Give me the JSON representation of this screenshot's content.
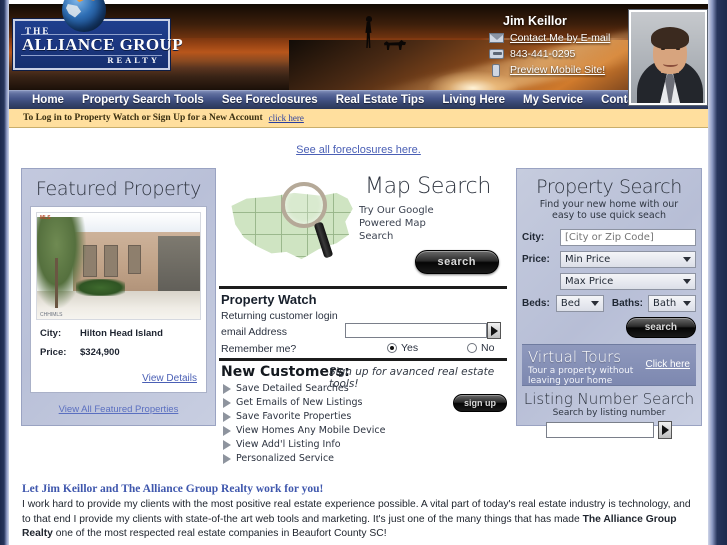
{
  "brand": {
    "logo_the": "THE",
    "logo_main": "ALLIANCE GROUP",
    "logo_realty": "REALTY"
  },
  "agent": {
    "name": "Jim Keillor",
    "email_link": "Contact Me by E-mail",
    "phone": "843-441-0295",
    "mobile_link": "Preview Mobile Site!"
  },
  "nav": {
    "items": [
      "Home",
      "Property Search Tools",
      "See Foreclosures",
      "Real Estate Tips",
      "Living Here",
      "My Service",
      "Contact"
    ]
  },
  "loginbar": {
    "text": "To Log in to Property Watch or Sign Up for a New Account",
    "link": "click here"
  },
  "foreclosure_link": "See all foreclosures here.",
  "featured": {
    "title": "Featured Property",
    "image_tag": "MLS",
    "image_mls": "CHHIMLS",
    "city_label": "City:",
    "city_value": "Hilton Head Island",
    "price_label": "Price:",
    "price_value": "$324,900",
    "view_details": "View Details",
    "view_all": "View All Featured Properties"
  },
  "map_search": {
    "title": "Map Search",
    "subtitle": "Try Our Google Powered Map Search",
    "button": "search"
  },
  "property_watch": {
    "title": "Property Watch",
    "subtitle": "Returning customer login",
    "email_label": "email Address",
    "email_value": "",
    "remember_label": "Remember me?",
    "yes_label": "Yes",
    "no_label": "No",
    "remember_selected": "Yes"
  },
  "new_customers": {
    "title": "New Customers:",
    "subtitle": "Sign up for avanced real estate tools!",
    "benefits_left": [
      "Save Detailed Searches",
      "Get Emails of New Listings",
      "Save Favorite Properties"
    ],
    "benefits_right": [
      "View Homes Any Mobile Device",
      "View Add'l Listing Info",
      "Personalized Service"
    ],
    "signup_button": "sign up"
  },
  "property_search": {
    "title": "Property Search",
    "subtitle_line1": "Find your new home with our",
    "subtitle_line2": "easy to use quick seach",
    "city_label": "City:",
    "city_placeholder": "[City or Zip Code]",
    "city_value": "",
    "price_label": "Price:",
    "min_price": "Min Price",
    "max_price": "Max Price",
    "beds_label": "Beds:",
    "beds_value": "Bed",
    "baths_label": "Baths:",
    "baths_value": "Bath",
    "search_button": "search"
  },
  "virtual_tours": {
    "title": "Virtual Tours",
    "subtitle_line1": "Tour a property without",
    "subtitle_line2": "leaving your home",
    "link": "Click here"
  },
  "listing_number_search": {
    "title": "Listing Number Search",
    "subtitle": "Search by listing number",
    "value": ""
  },
  "bottom": {
    "heading": "Let Jim Keillor and The Alliance Group Realty work for you!",
    "paragraph_a": "I work hard to provide my clients with the most positive real estate experience possible. A vital part of today's real estate industry is technology, and to that end I provide my clients with state-of-the art web tools and marketing. It's just one of the many things that has made ",
    "paragraph_b": "The Alliance Group Realty",
    "paragraph_c": " one of the most respected real estate companies in Beaufort County SC!"
  },
  "colors": {
    "nav_blue": "#36456f",
    "banner_orange": "#b8561b",
    "login_gold": "#ffdf9e",
    "link_blue": "#4a5fb5",
    "panel_lavender": "#c3c9de"
  }
}
